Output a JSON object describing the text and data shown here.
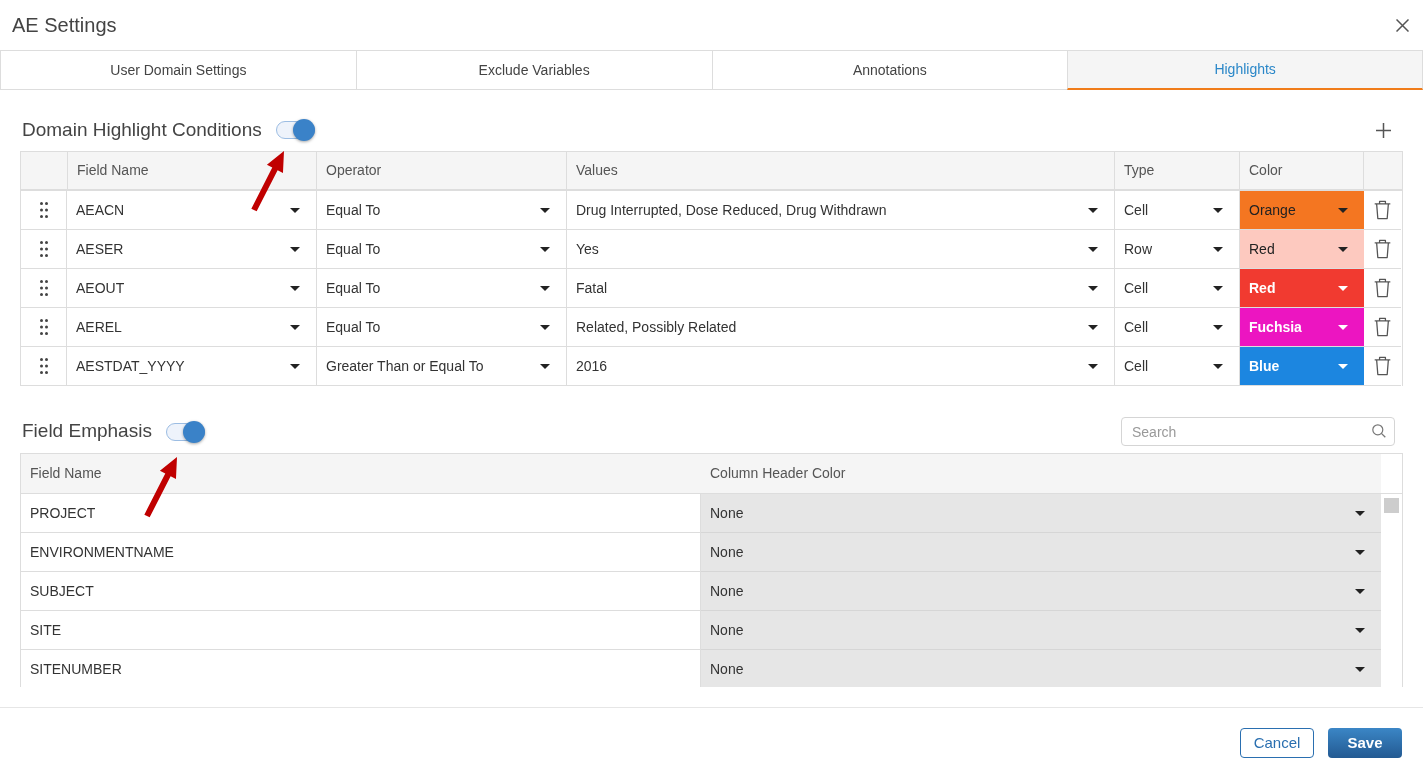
{
  "window": {
    "title": "AE Settings"
  },
  "tabs": [
    {
      "label": "User Domain Settings",
      "selected": false
    },
    {
      "label": "Exclude Variables",
      "selected": false
    },
    {
      "label": "Annotations",
      "selected": false
    },
    {
      "label": "Highlights",
      "selected": true
    }
  ],
  "highlight_conditions": {
    "title": "Domain Highlight Conditions",
    "enabled": true,
    "columns": [
      "Field Name",
      "Operator",
      "Values",
      "Type",
      "Color"
    ],
    "rows": [
      {
        "field_name": "AEACN",
        "operator": "Equal To",
        "values": "Drug Interrupted, Dose Reduced, Drug Withdrawn",
        "type": "Cell",
        "color_name": "Orange",
        "color": "#f47621"
      },
      {
        "field_name": "AESER",
        "operator": "Equal To",
        "values": "Yes",
        "type": "Row",
        "color_name": "Red",
        "color": "#fdc9bf"
      },
      {
        "field_name": "AEOUT",
        "operator": "Equal To",
        "values": "Fatal",
        "type": "Cell",
        "color_name": "Red",
        "color": "#f13a30"
      },
      {
        "field_name": "AEREL",
        "operator": "Equal To",
        "values": "Related, Possibly Related",
        "type": "Cell",
        "color_name": "Fuchsia",
        "color": "#ec15c1"
      },
      {
        "field_name": "AESTDAT_YYYY",
        "operator": "Greater Than or Equal To",
        "values": "2016",
        "type": "Cell",
        "color_name": "Blue",
        "color": "#1c86e0"
      }
    ]
  },
  "field_emphasis": {
    "title": "Field Emphasis",
    "enabled": true,
    "search": {
      "placeholder": "Search"
    },
    "columns": [
      "Field Name",
      "Column Header Color"
    ],
    "rows": [
      {
        "field_name": "PROJECT",
        "header_color": "None"
      },
      {
        "field_name": "ENVIRONMENTNAME",
        "header_color": "None"
      },
      {
        "field_name": "SUBJECT",
        "header_color": "None"
      },
      {
        "field_name": "SITE",
        "header_color": "None"
      },
      {
        "field_name": "SITENUMBER",
        "header_color": "None"
      }
    ]
  },
  "buttons": [
    {
      "label": "Cancel",
      "kind": "secondary"
    },
    {
      "label": "Save",
      "kind": "primary"
    }
  ]
}
